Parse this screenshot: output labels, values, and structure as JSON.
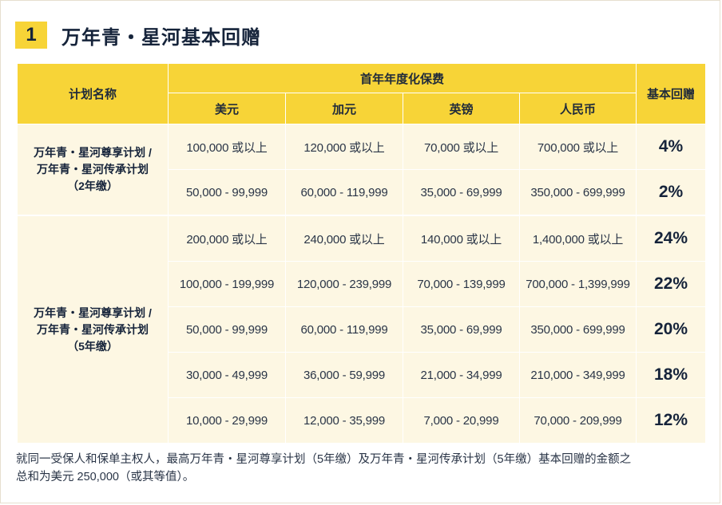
{
  "section": {
    "number": "1",
    "title": "万年青・星河基本回赠"
  },
  "table": {
    "header": {
      "plan_name": "计划名称",
      "premium_group": "首年年度化保费",
      "rebate": "基本回赠",
      "currencies": [
        "美元",
        "加元",
        "英镑",
        "人民币"
      ]
    },
    "groups": [
      {
        "plan_lines": [
          "万年青・星河尊享计划 /",
          "万年青・星河传承计划",
          "（2年缴）"
        ],
        "rows": [
          {
            "usd": "100,000 或以上",
            "cad": "120,000 或以上",
            "gbp": "70,000 或以上",
            "rmb": "700,000 或以上",
            "rebate": "4%"
          },
          {
            "usd": "50,000 - 99,999",
            "cad": "60,000 - 119,999",
            "gbp": "35,000 - 69,999",
            "rmb": "350,000 - 699,999",
            "rebate": "2%"
          }
        ]
      },
      {
        "plan_lines": [
          "万年青・星河尊享计划 /",
          "万年青・星河传承计划",
          "（5年缴）"
        ],
        "rows": [
          {
            "usd": "200,000 或以上",
            "cad": "240,000 或以上",
            "gbp": "140,000 或以上",
            "rmb": "1,400,000 或以上",
            "rebate": "24%"
          },
          {
            "usd": "100,000 - 199,999",
            "cad": "120,000 - 239,999",
            "gbp": "70,000 - 139,999",
            "rmb": "700,000 - 1,399,999",
            "rebate": "22%"
          },
          {
            "usd": "50,000 - 99,999",
            "cad": "60,000 - 119,999",
            "gbp": "35,000 - 69,999",
            "rmb": "350,000 - 699,999",
            "rebate": "20%"
          },
          {
            "usd": "30,000 - 49,999",
            "cad": "36,000 - 59,999",
            "gbp": "21,000 - 34,999",
            "rmb": "210,000 - 349,999",
            "rebate": "18%"
          },
          {
            "usd": "10,000 - 29,999",
            "cad": "12,000 - 35,999",
            "gbp": "7,000 - 20,999",
            "rmb": "70,000 - 209,999",
            "rebate": "12%"
          }
        ]
      }
    ]
  },
  "footnote": {
    "line1": "就同一受保人和保单主权人，最高万年青・星河尊享计划（5年缴）及万年青・星河传承计划（5年缴）基本回赠的金额之",
    "line2": "总和为美元 250,000（或其等值）。"
  },
  "colors": {
    "accent": "#f7d437",
    "row_bg": "#fdf7e3",
    "text_dark": "#15233a"
  }
}
